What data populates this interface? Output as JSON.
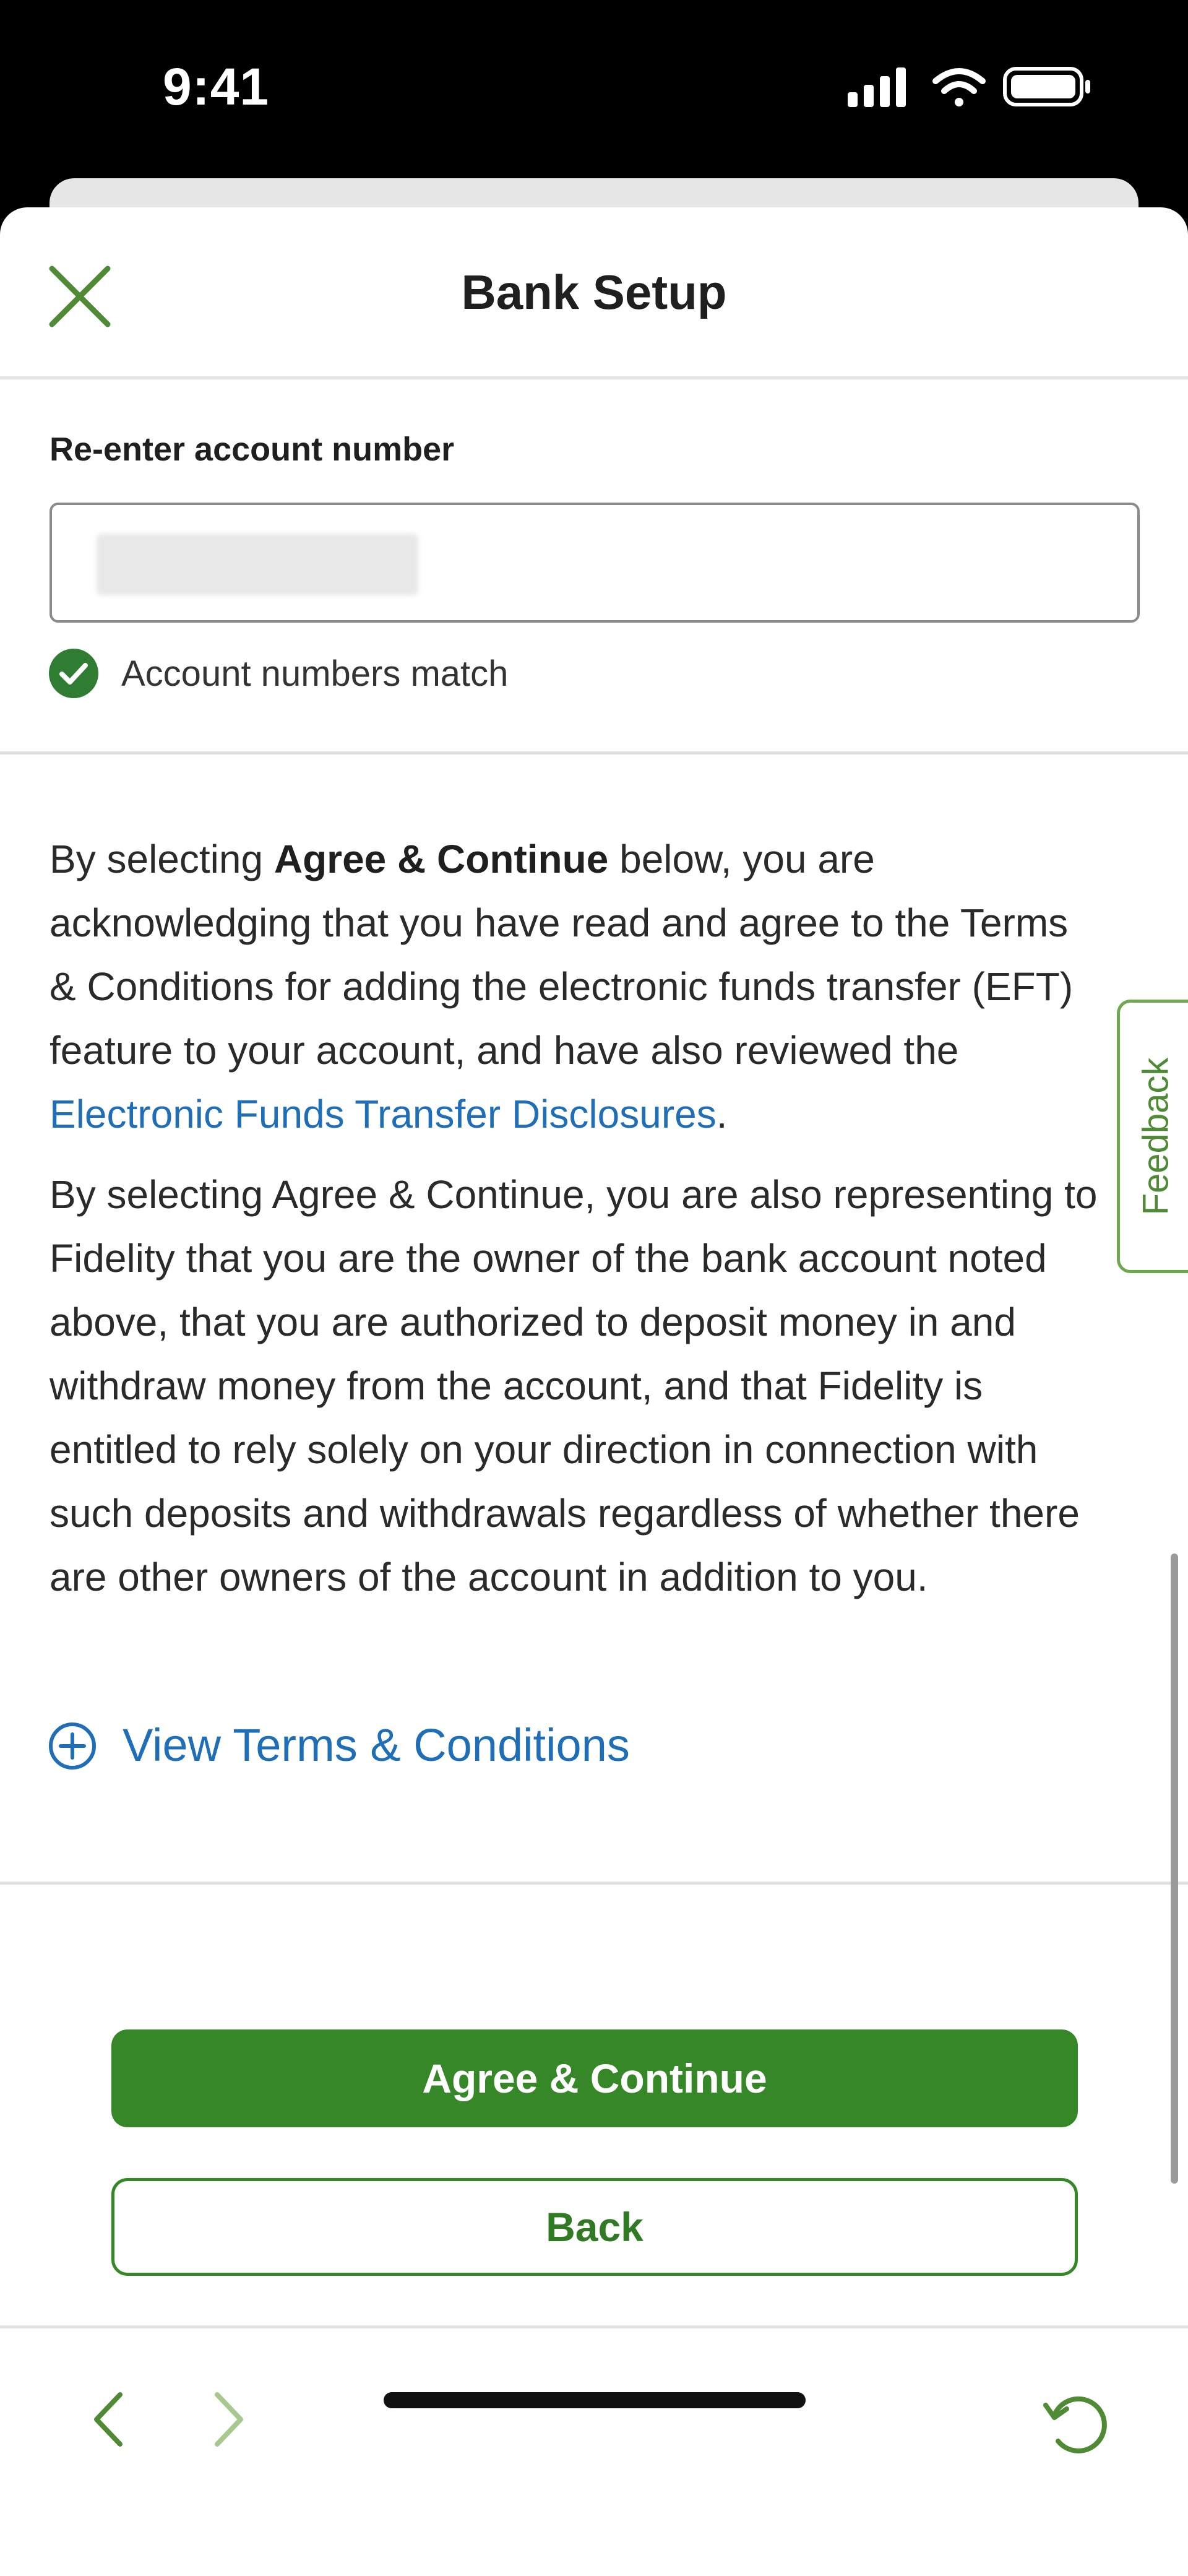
{
  "status_bar": {
    "time": "9:41",
    "icons": [
      "signal-icon",
      "wifi-icon",
      "battery-icon"
    ]
  },
  "header": {
    "title": "Bank Setup",
    "close_icon": "close-icon"
  },
  "form": {
    "reenter_label": "Re-enter account number",
    "match_message": "Account numbers match"
  },
  "disclosure": {
    "p1_prefix": "By selecting ",
    "p1_bold": "Agree & Continue",
    "p1_middle": " below, you are acknowledging that you have read and agree to the Terms & Conditions for adding the electronic funds transfer (EFT) feature to your account, and have also reviewed the ",
    "p1_link": "Electronic Funds Transfer Disclosures",
    "p1_suffix": ".",
    "p2": "By selecting Agree & Continue, you are also representing to Fidelity that you are the owner of the bank account noted above, that you are authorized to deposit money in and withdraw money from the account, and that Fidelity is entitled to rely solely on your direction in connection with such deposits and withdrawals regardless of whether there are other owners of the account in addition to you."
  },
  "terms": {
    "label": "View Terms & Conditions"
  },
  "actions": {
    "agree_label": "Agree & Continue",
    "back_label": "Back"
  },
  "feedback": {
    "label": "Feedback"
  },
  "colors": {
    "primary_green": "#368727",
    "link_blue": "#1f6eb8",
    "success_green": "#2e7d32"
  }
}
